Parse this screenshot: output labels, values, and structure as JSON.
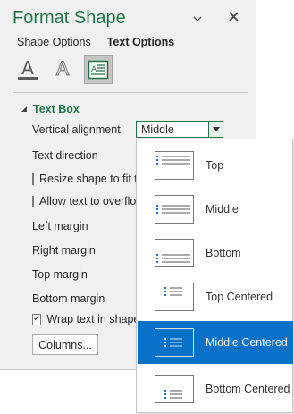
{
  "pane": {
    "title": "Format Shape",
    "tabs": [
      {
        "label": "Shape Options",
        "active": false
      },
      {
        "label": "Text Options",
        "active": true
      }
    ],
    "icons": [
      "text-fill-outline-icon",
      "text-effects-icon",
      "textbox-icon"
    ],
    "section": {
      "label": "Text Box",
      "expanded": true
    },
    "vertical_alignment": {
      "label": "Vertical alignment",
      "value": "Middle"
    },
    "text_direction": {
      "label": "Text direction"
    },
    "resize_shape": {
      "label": "Resize shape to fit text",
      "checked": false
    },
    "allow_overflow": {
      "label": "Allow text to overflow shape",
      "checked": false
    },
    "left_margin": "Left margin",
    "right_margin": "Right margin",
    "top_margin": "Top margin",
    "bottom_margin": "Bottom margin",
    "wrap_text": {
      "label": "Wrap text in shape",
      "checked": true
    },
    "columns_button": "Columns...",
    "accent_color": "#217346"
  },
  "dropdown": {
    "options": [
      {
        "label": "Top",
        "selected": false
      },
      {
        "label": "Middle",
        "selected": false
      },
      {
        "label": "Bottom",
        "selected": false
      },
      {
        "label": "Top Centered",
        "selected": false
      },
      {
        "label": "Middle Centered",
        "selected": true
      },
      {
        "label": "Bottom Centered",
        "selected": false
      }
    ],
    "selection_color": "#0a72c6"
  }
}
